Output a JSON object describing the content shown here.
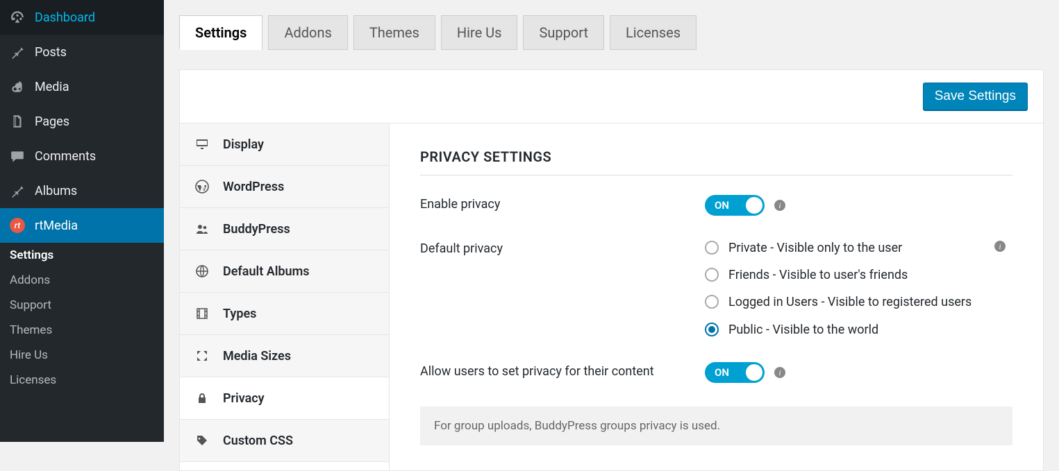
{
  "sidebar": {
    "items": [
      {
        "label": "Dashboard"
      },
      {
        "label": "Posts"
      },
      {
        "label": "Media"
      },
      {
        "label": "Pages"
      },
      {
        "label": "Comments"
      },
      {
        "label": "Albums"
      },
      {
        "label": "rtMedia"
      }
    ],
    "submenu": [
      {
        "label": "Settings"
      },
      {
        "label": "Addons"
      },
      {
        "label": "Support"
      },
      {
        "label": "Themes"
      },
      {
        "label": "Hire Us"
      },
      {
        "label": "Licenses"
      }
    ]
  },
  "tabs": [
    {
      "label": "Settings"
    },
    {
      "label": "Addons"
    },
    {
      "label": "Themes"
    },
    {
      "label": "Hire Us"
    },
    {
      "label": "Support"
    },
    {
      "label": "Licenses"
    }
  ],
  "actions": {
    "save": "Save Settings"
  },
  "settings_nav": [
    {
      "label": "Display"
    },
    {
      "label": "WordPress"
    },
    {
      "label": "BuddyPress"
    },
    {
      "label": "Default Albums"
    },
    {
      "label": "Types"
    },
    {
      "label": "Media Sizes"
    },
    {
      "label": "Privacy"
    },
    {
      "label": "Custom CSS"
    }
  ],
  "content": {
    "heading": "PRIVACY SETTINGS",
    "enable_privacy_label": "Enable privacy",
    "default_privacy_label": "Default privacy",
    "allow_user_privacy_label": "Allow users to set privacy for their content",
    "toggle_on_text": "ON",
    "privacy_options": [
      {
        "label": "Private - Visible only to the user"
      },
      {
        "label": "Friends - Visible to user's friends"
      },
      {
        "label": "Logged in Users - Visible to registered users"
      },
      {
        "label": "Public - Visible to the world"
      }
    ],
    "note": "For group uploads, BuddyPress groups privacy is used."
  }
}
